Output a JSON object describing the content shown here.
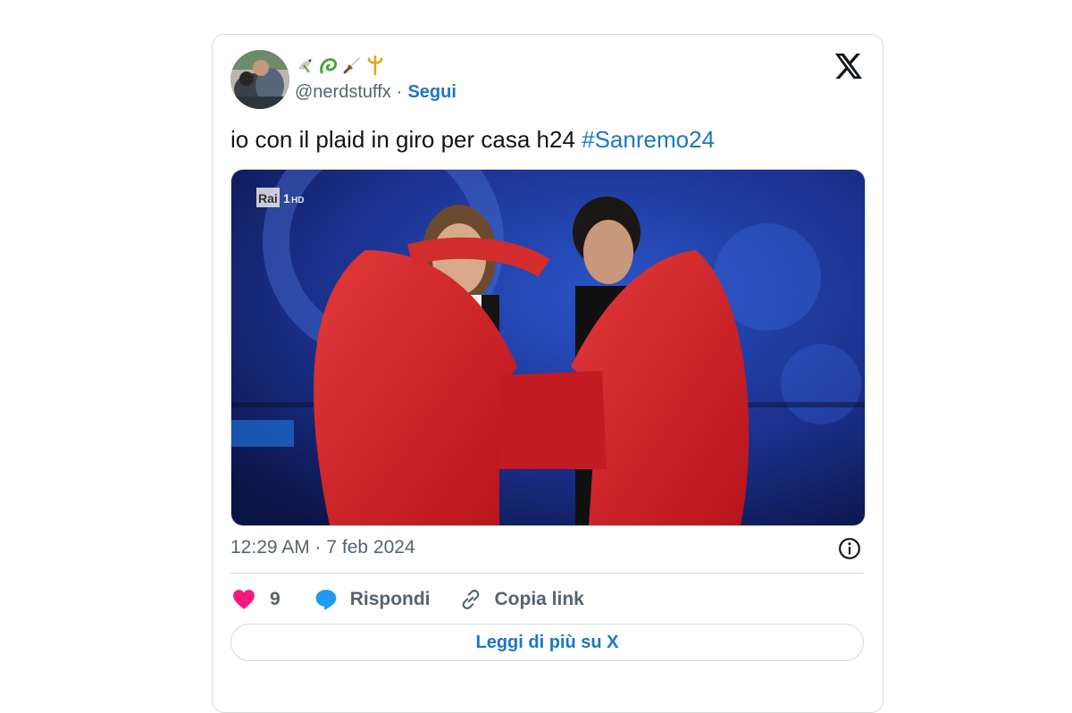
{
  "tweet": {
    "display_name_emojis": [
      "dove-emoji",
      "dragon-emoji",
      "dagger-emoji",
      "trident-emoji"
    ],
    "handle": "@nerdstuffx",
    "separator": "·",
    "follow_label": "Segui",
    "text": "io con il plaid in giro per casa h24 ",
    "hashtag": "#Sanremo24",
    "media": {
      "channel_logo": "Rai",
      "channel_number": "1",
      "channel_suffix": "HD"
    },
    "timestamp": "12:29 AM · 7 feb 2024",
    "actions": {
      "likes_count": "9",
      "reply_label": "Rispondi",
      "copy_link_label": "Copia link"
    },
    "read_more_label": "Leggi di più su X"
  },
  "colors": {
    "link_blue": "#1d75c9",
    "like_pink": "#f91880",
    "reply_blue": "#1d9bf0",
    "border": "#cfd9de",
    "muted": "#536471"
  }
}
